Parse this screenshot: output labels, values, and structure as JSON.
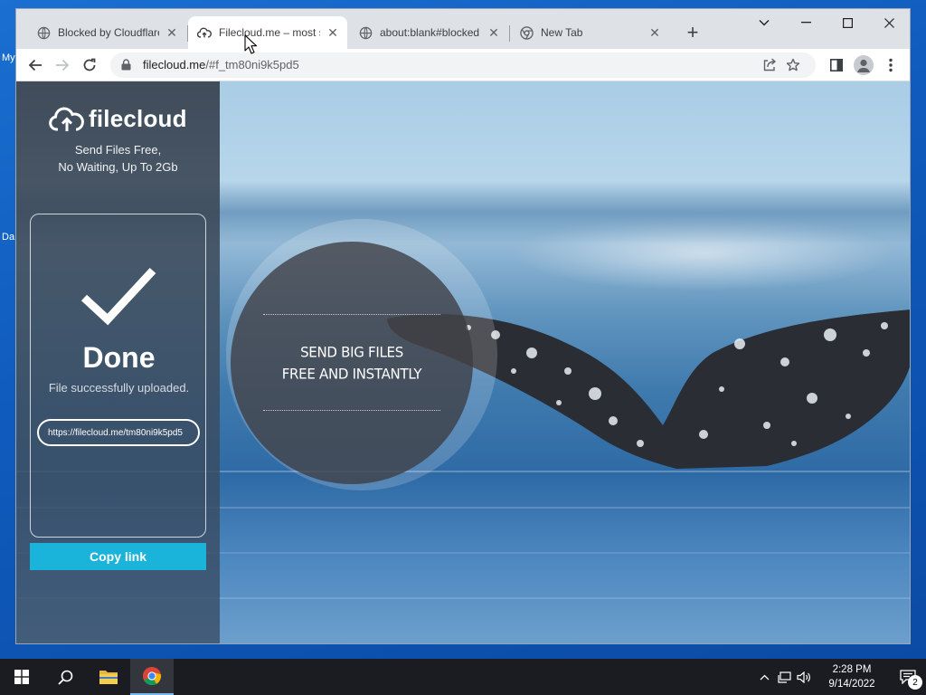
{
  "desktop": {
    "labels": [
      "My",
      "Da"
    ]
  },
  "browser": {
    "tabs": [
      {
        "title": "Blocked by Cloudflare",
        "icon": "globe-icon",
        "active": false
      },
      {
        "title": "Filecloud.me – most s",
        "icon": "cloud-upload-icon",
        "active": true
      },
      {
        "title": "about:blank#blocked",
        "icon": "globe-icon",
        "active": false
      },
      {
        "title": "New Tab",
        "icon": "chrome-icon",
        "active": false
      }
    ],
    "new_tab_label": "+",
    "url_host": "filecloud.me",
    "url_path": "/#f_tm80ni9k5pd5"
  },
  "page": {
    "logo_text": "filecloud",
    "tagline_line1": "Send Files Free,",
    "tagline_line2": "No Waiting, Up To 2Gb",
    "done_title": "Done",
    "done_subtitle": "File successfully uploaded.",
    "share_link": "https://filecloud.me/tm80ni9k5pd5",
    "copy_button": "Copy link",
    "slogan_line1": "SEND BIG FILES",
    "slogan_line2": "FREE AND INSTANTLY"
  },
  "taskbar": {
    "time": "2:28 PM",
    "date": "9/14/2022",
    "notification_count": "2"
  },
  "colors": {
    "accent": "#1ab3d9",
    "taskbar": "#1a1c22",
    "tab_strip": "#dee1e6"
  }
}
